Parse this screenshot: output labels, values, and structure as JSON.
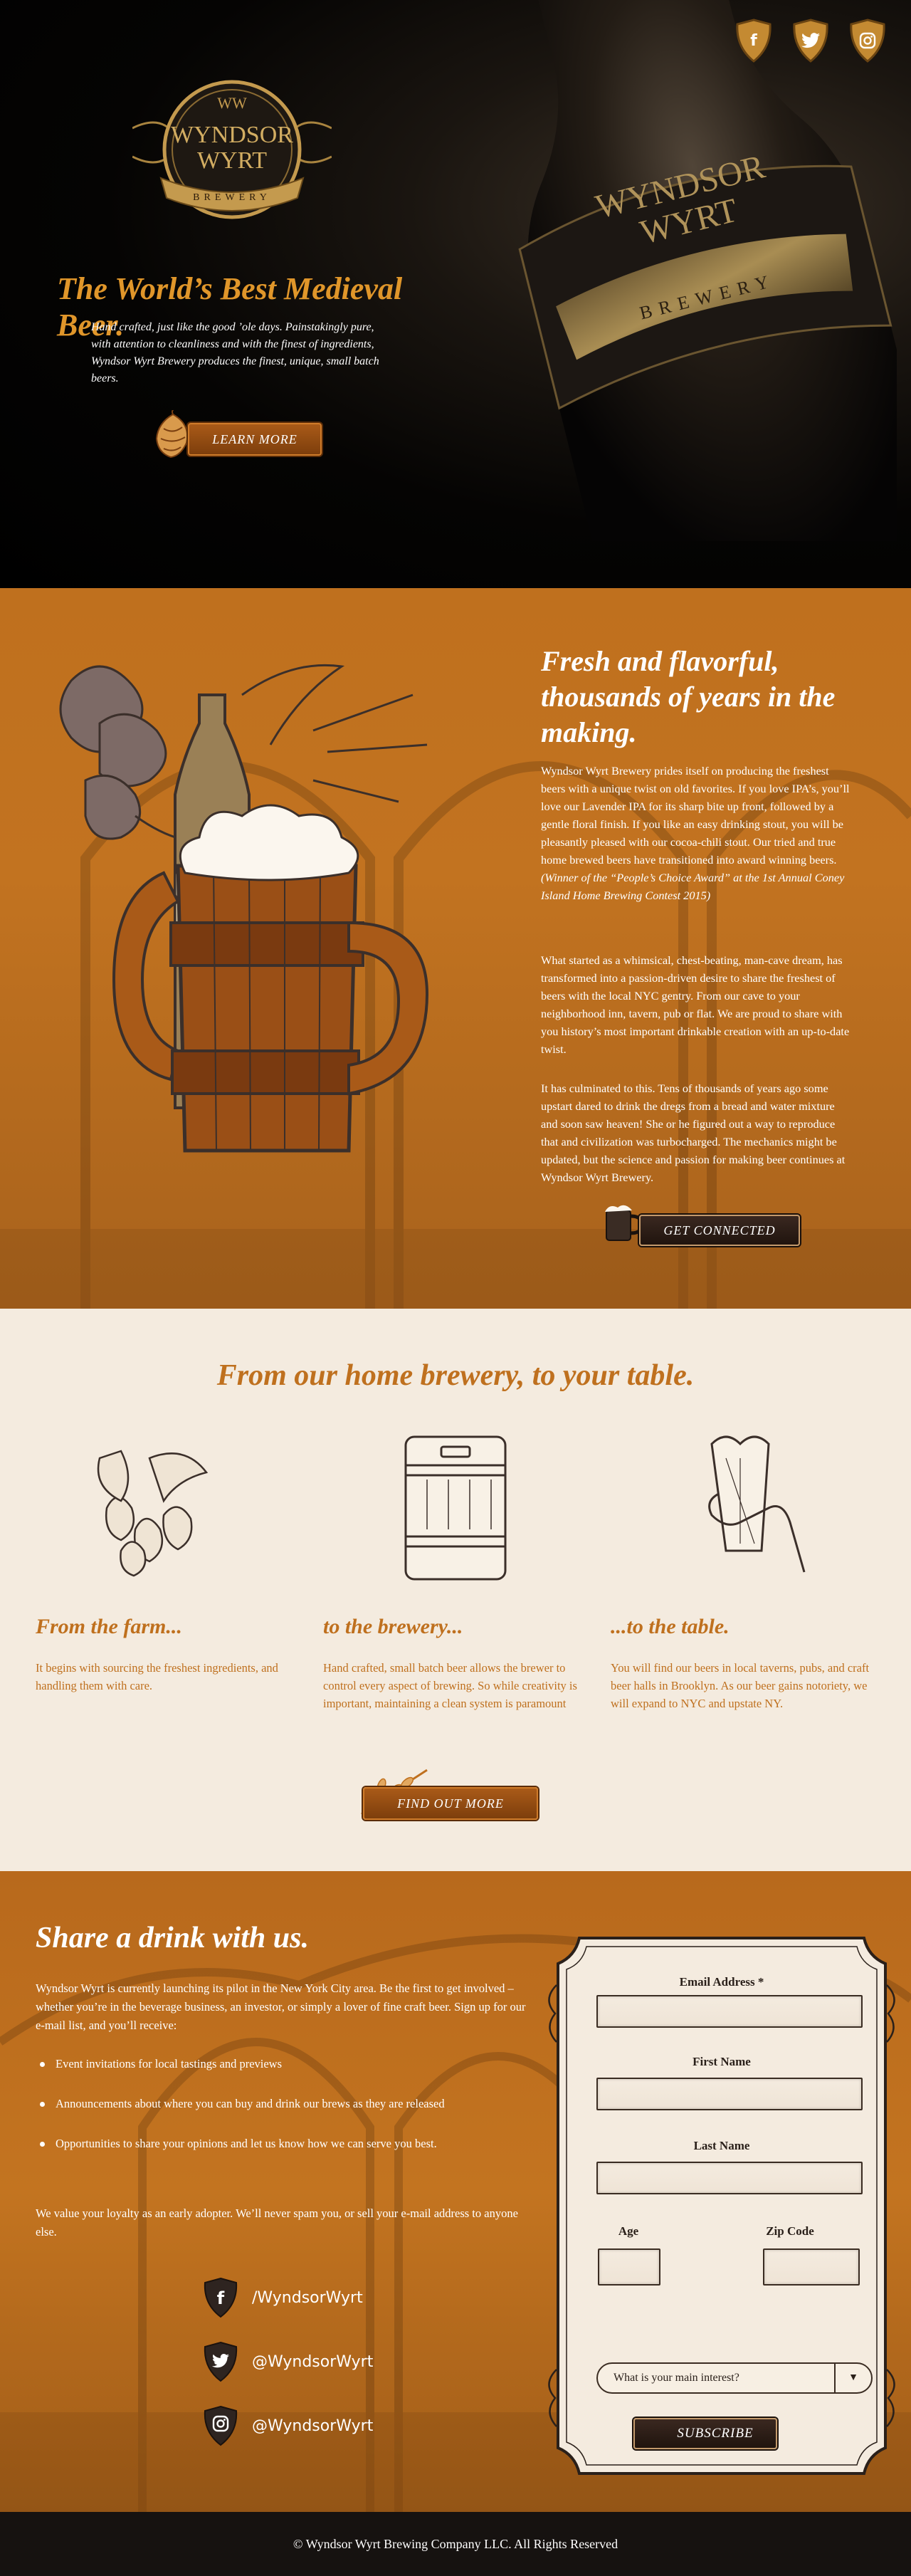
{
  "hero": {
    "logo_text_1": "WYNDSOR",
    "logo_text_2": "WYRT",
    "logo_subtext": "BREWERY",
    "logo_monogram": "WW",
    "bottle_label_1": "WYNDSOR",
    "bottle_label_2": "WYRT",
    "bottle_label_sub": "BREWERY",
    "title": "The World’s Best Medieval Beer.",
    "text": "Hand crafted, just like the good ’ole days. Painstakingly pure, with attention to cleanliness and with the finest of ingredients, Wyndsor Wyrt Brewery produces the finest, unique, small batch beers.",
    "cta_label": "LEARN MORE",
    "social_icons": [
      "facebook-icon",
      "twitter-icon",
      "instagram-icon"
    ]
  },
  "story": {
    "title": "Fresh and flavorful, thousands of years in the making.",
    "p1": "Wyndsor Wyrt Brewery prides itself on producing the freshest beers with a unique twist on old favorites. If you love IPA’s, you’ll love our Lavender IPA for its sharp bite up front, followed by a gentle floral finish. If you like an easy drinking stout, you will be pleasantly pleased with our cocoa-chili stout. Our tried and true home brewed beers have transitioned into award winning beers.",
    "p1_award": "(Winner of the “People’s Choice Award” at the 1st Annual Coney Island Home Brewing Contest 2015)",
    "p2": "What started as a whimsical, chest-beating, man-cave dream, has transformed into a passion-driven desire to share the freshest of beers with the local NYC gentry. From our cave to your neighborhood inn, tavern, pub or flat. We are proud to share with you history’s most important drinkable creation with an up-to-date twist.",
    "p3": "It has culminated to this. Tens of thousands of years ago some upstart dared to drink the dregs from a bread and water mixture and soon saw heaven! She or he figured out a way to reproduce that and civilization was turbocharged. The mechanics might be updated, but the science and passion for making beer continues at Wyndsor Wyrt Brewery.",
    "cta_label": "GET CONNECTED"
  },
  "process": {
    "title": "From our home brewery, to your table.",
    "columns": [
      {
        "title": "From the farm...",
        "text": "It begins with sourcing the freshest ingredients, and handling them with care.",
        "icon": "hops-icon"
      },
      {
        "title": "to the brewery...",
        "text": "Hand crafted, small batch beer allows the brewer to control every aspect of brewing. So while creativity is important, maintaining a clean system is paramount",
        "icon": "keg-icon"
      },
      {
        "title": "...to the table.",
        "text": "You will find our beers in local taverns, pubs, and craft beer halls in Brooklyn. As our beer gains notoriety, we will expand to NYC and upstate NY.",
        "icon": "beer-glass-icon"
      }
    ],
    "cta_label": "FIND OUT MORE"
  },
  "signup": {
    "title": "Share a drink with us.",
    "intro": "Wyndsor Wyrt is currently launching its pilot in the New York City area. Be the first to get involved – whether you’re in the beverage business, an investor, or simply a lover of fine craft beer. Sign up for our e-mail list, and you’ll receive:",
    "bullets": [
      "Event invitations for local tastings and previews",
      "Announcements about where you can buy and drink our brews as they are released",
      "Opportunities to share your opinions and let us know how we can serve you best."
    ],
    "closing": "We value your loyalty as an early adopter. We’ll never spam you, or sell your e-mail address to anyone else.",
    "social": [
      {
        "icon": "facebook-icon",
        "handle": "/WyndsorWyrt"
      },
      {
        "icon": "twitter-icon",
        "handle": "@WyndsorWyrt"
      },
      {
        "icon": "instagram-icon",
        "handle": "@WyndsorWyrt"
      }
    ],
    "form": {
      "email_label": "Email Address *",
      "first_name_label": "First Name",
      "last_name_label": "Last Name",
      "age_label": "Age",
      "zip_label": "Zip Code",
      "email_value": "",
      "first_name_value": "",
      "last_name_value": "",
      "age_value": "",
      "zip_value": "",
      "interest_placeholder": "What is your main interest?",
      "submit_label": "SUBSCRIBE"
    }
  },
  "footer": {
    "copyright": "© Wyndsor Wyrt Brewing Company LLC. All Rights Reserved"
  },
  "colors": {
    "accent_orange": "#bf701e",
    "hero_title_orange": "#e0962a",
    "cream": "#f4ebdf",
    "dark_brown": "#2a201a",
    "footer_bg": "#161210"
  }
}
